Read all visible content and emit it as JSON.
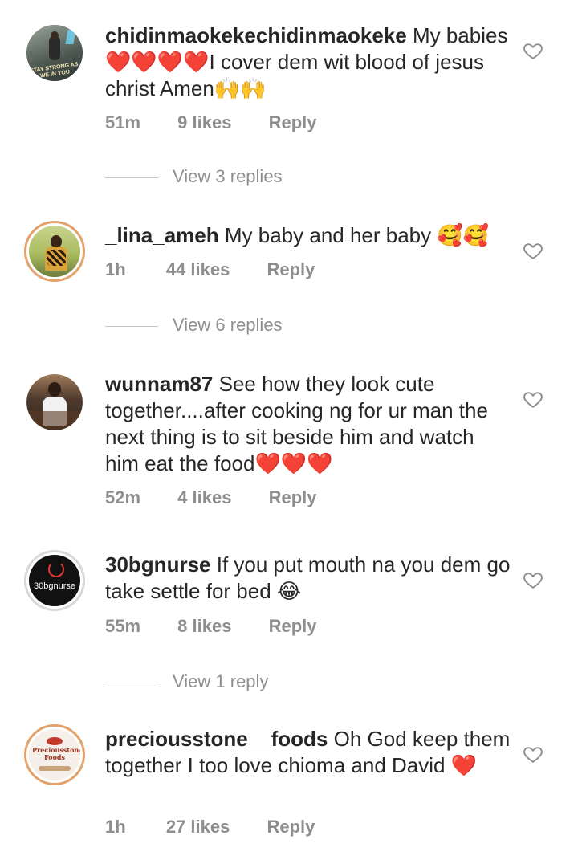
{
  "comments": [
    {
      "username": "chidinmaokekechidinmaokeke",
      "text": "My babies❤️❤️❤️❤️I cover dem wit blood of jesus  christ Amen🙌🙌",
      "time": "51m",
      "likes": "9 likes",
      "reply": "Reply",
      "avatar_caption": "STAY STRONG AS WE IN YOU"
    },
    {
      "username": "_lina_ameh",
      "text": "My baby and her baby 🥰🥰",
      "time": "1h",
      "likes": "44 likes",
      "reply": "Reply"
    },
    {
      "username": "wunnam87",
      "text": "See how they look cute together....after cooking ng for ur man the next thing is to sit beside him and watch him eat the food❤️❤️❤️",
      "time": "52m",
      "likes": "4 likes",
      "reply": "Reply"
    },
    {
      "username": "30bgnurse",
      "text": "If you put mouth na you dem go take settle for bed 😂",
      "time": "55m",
      "likes": "8 likes",
      "reply": "Reply",
      "avatar_caption": "30bgnurse"
    },
    {
      "username": "preciousstone__foods",
      "text": "Oh God keep them together I too love chioma and David ❤️",
      "time": "1h",
      "likes": "27 likes",
      "reply": "Reply",
      "avatar_caption": "Preciousstone Foods"
    }
  ],
  "view_replies": [
    "View 3 replies",
    "View 6 replies",
    "View 1 reply"
  ],
  "icons": {
    "like": "heart-outline-icon"
  },
  "colors": {
    "text": "#262626",
    "muted": "#8e8e8e",
    "story_ring": "#e3a26b"
  }
}
